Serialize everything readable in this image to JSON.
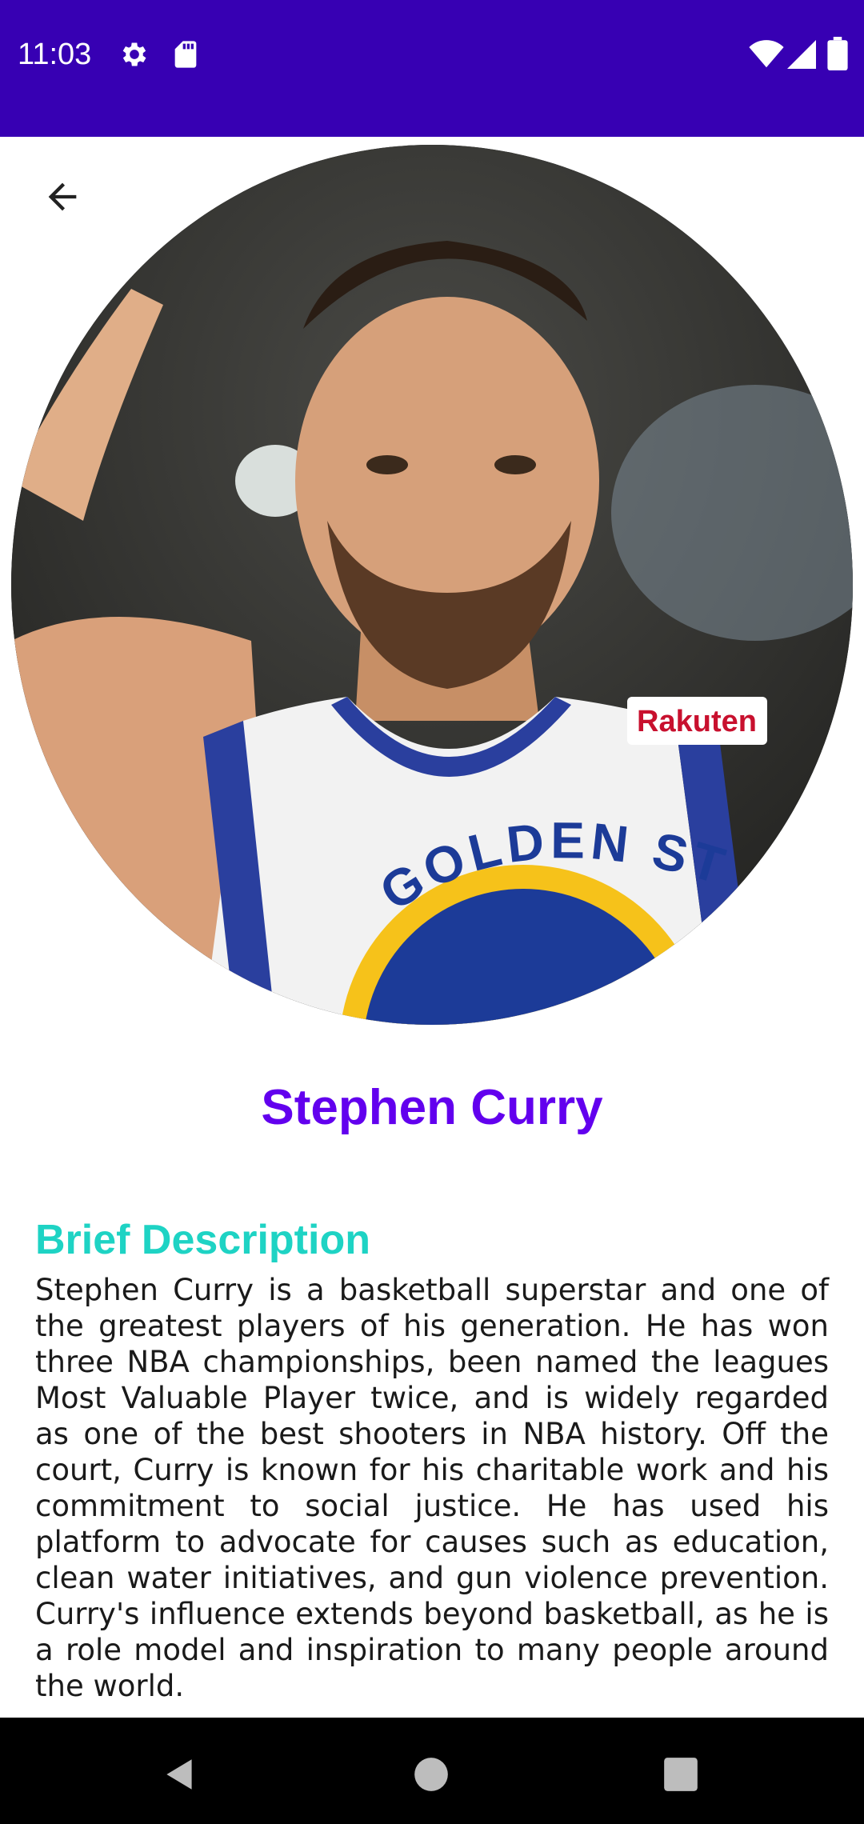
{
  "status_bar": {
    "time": "11:03",
    "icons": [
      "gear-icon",
      "sd-card-icon",
      "wifi-icon",
      "signal-icon",
      "battery-icon"
    ],
    "background": "#3700B3"
  },
  "header": {
    "back_icon": "arrow-left-icon"
  },
  "player": {
    "name": "Stephen Curry",
    "name_color": "#6200EE",
    "jersey_text": "GOLDEN STATE",
    "sponsor": "Rakuten"
  },
  "description": {
    "heading": "Brief Description",
    "heading_color": "#1ED3C4",
    "body": "Stephen Curry is a basketball superstar and one of the greatest players of his generation. He has won three NBA championships, been named the leagues Most Valuable Player twice, and is widely regarded as one of the best shooters in NBA history. Off the court, Curry is known for his charitable work and his commitment to social justice. He has used his platform to advocate for causes such as education, clean water initiatives, and gun violence prevention. Curry's influence extends beyond basketball, as he is a role model and inspiration to many people around the world."
  },
  "nav_bar": {
    "icons": [
      "nav-back-icon",
      "nav-home-icon",
      "nav-recents-icon"
    ]
  }
}
